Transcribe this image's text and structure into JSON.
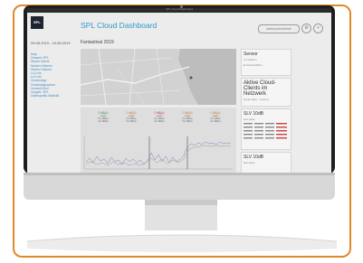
{
  "menubar": {
    "title": "SPL Cloud Dashboard"
  },
  "header": {
    "logo_text": "SPL",
    "title": "SPL Cloud Dashboard",
    "period_button": "select period/time",
    "date_range": "09.08.2019 - 10.08.2019"
  },
  "sidebar": {
    "items": [
      "Map",
      "Gesamt SPL",
      "Stufen-Werte",
      "Marker-Historie",
      "Stufen-Historie",
      "Lcl Lvls",
      "Lcl Lvls",
      "Zustandsgr.",
      "Zustandsgraphen",
      "Umwelt-Sinn",
      "Umgeb. SPL",
      "Datengrafik-Statistik"
    ]
  },
  "main": {
    "section_title": "Fantastival 2019"
  },
  "kpis": [
    {
      "value": "0 dB(A)",
      "color": "#3c9d4a",
      "lines": [
        "LAeq",
        "0.0 dB(A)",
        "0.0 dB(A)",
        "0.0 dB(A)"
      ]
    },
    {
      "value": "0 dB(A)",
      "color": "#d07a26",
      "lines": [
        "LAeq",
        "0.0 dB(A)",
        "0.0 dB(A)",
        "0.0 dB(A)"
      ]
    },
    {
      "value": "0 dB(A)",
      "color": "#c94141",
      "lines": [
        "LAeq",
        "0.0 dB(A)",
        "0.0 dB(A)",
        "0.0 dB(A)"
      ]
    },
    {
      "value": "0 dB(A)",
      "color": "#d07a26",
      "lines": [
        "LAeq",
        "0.0 dB(A)",
        "0.0 dB(A)",
        "0.0 dB(A)"
      ]
    },
    {
      "value": "0 dB(A)",
      "color": "#d07a26",
      "lines": [
        "LAeq",
        "0.0 dB(A)",
        "0.0 dB(A)",
        "0.0 dB(A)"
      ]
    }
  ],
  "cards": {
    "sensor": {
      "title": "Sensor",
      "sub": "no location",
      "status": "Online/Offline"
    },
    "clients": {
      "title": "Aktive Cloud-Clients im Netzwerk",
      "a": "Heute aktiv",
      "b": "Gesamt"
    },
    "slv1": {
      "title": "SLV 10dB",
      "sub": "last value"
    },
    "slv2": {
      "title": "SLV 10dB",
      "sub": "last value"
    }
  },
  "colors": {
    "accent": "#2c9acb",
    "frame": "#e0892a"
  }
}
